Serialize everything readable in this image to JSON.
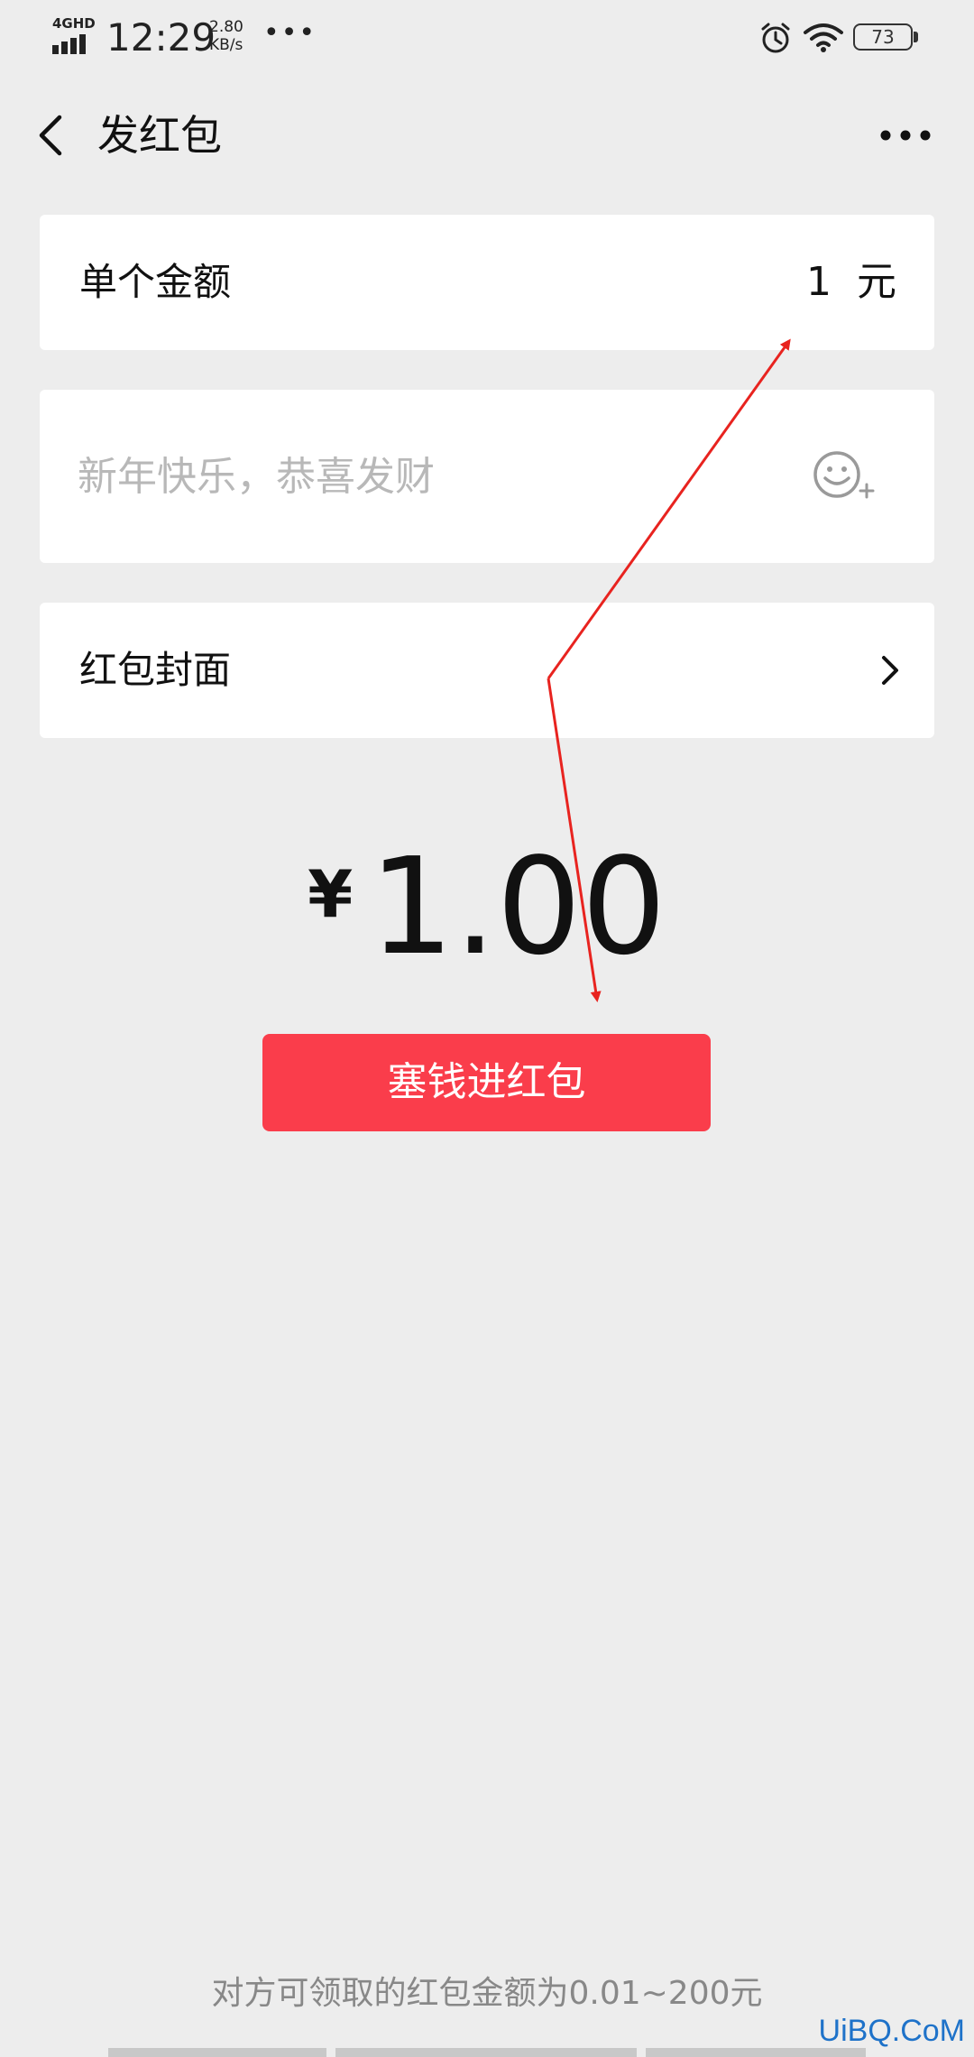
{
  "status_bar": {
    "network": "4GHD",
    "time": "12:29",
    "speed_value": "2.80",
    "speed_unit": "KB/s",
    "more": "•••",
    "battery": "73"
  },
  "header": {
    "title": "发红包"
  },
  "amount_card": {
    "label": "单个金额",
    "value": "1",
    "unit": "元"
  },
  "message_card": {
    "placeholder": "新年快乐，恭喜发财",
    "value": ""
  },
  "cover_card": {
    "label": "红包封面"
  },
  "total": {
    "currency": "¥",
    "amount": "1.00"
  },
  "submit": {
    "label": "塞钱进红包"
  },
  "footer": {
    "note": "对方可领取的红包金额为0.01~200元"
  },
  "watermark": {
    "text": "UiBQ.CoM"
  },
  "colors": {
    "background": "#ededed",
    "card": "#ffffff",
    "submit_button": "#fa3d4b",
    "annotation_arrow": "#e8231f",
    "watermark": "#1e72c9"
  },
  "icons": {
    "back": "chevron-left-icon",
    "more": "more-icon",
    "emoji": "emoji-add-icon",
    "chevron": "chevron-right-icon",
    "alarm": "alarm-icon",
    "wifi": "wifi-icon",
    "battery": "battery-icon",
    "signal": "signal-icon"
  }
}
